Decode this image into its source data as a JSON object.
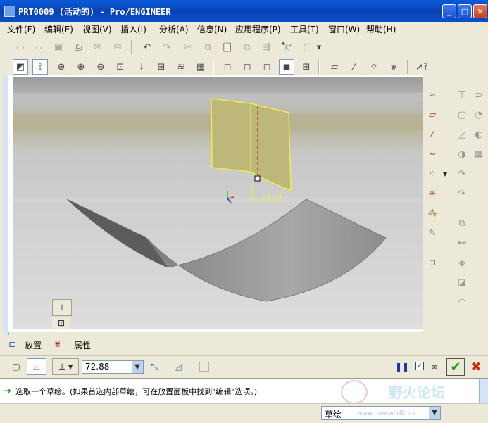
{
  "window": {
    "title": "PRT0009 (活动的) - Pro/ENGINEER",
    "minimize_glyph": "_",
    "maximize_glyph": "□",
    "close_glyph": "✕"
  },
  "menu": [
    "文件(F)",
    "编辑(E)",
    "视图(V)",
    "插入(I)",
    "分析(A)",
    "信息(N)",
    "应用程序(P)",
    "工具(T)",
    "窗口(W)",
    "帮助(H)"
  ],
  "viewport": {
    "dimension_value": "72.88"
  },
  "dashboard": {
    "tab_placement": "放置",
    "tab_properties": "属性",
    "depth_value": "72.88"
  },
  "status": {
    "message": "选取一个草绘。(如果首选内部草绘，可在放置面板中找到\"编辑\"选项。)"
  },
  "filter": {
    "selected": "草绘"
  },
  "watermark": {
    "text": "野火论坛",
    "url": "www.proewildfire.cn"
  },
  "colors": {
    "titlebar": "#0a4fc8",
    "surface_yellow": "#bdb77a",
    "accept_green": "#1e9a1e",
    "cancel_red": "#d02a10"
  }
}
